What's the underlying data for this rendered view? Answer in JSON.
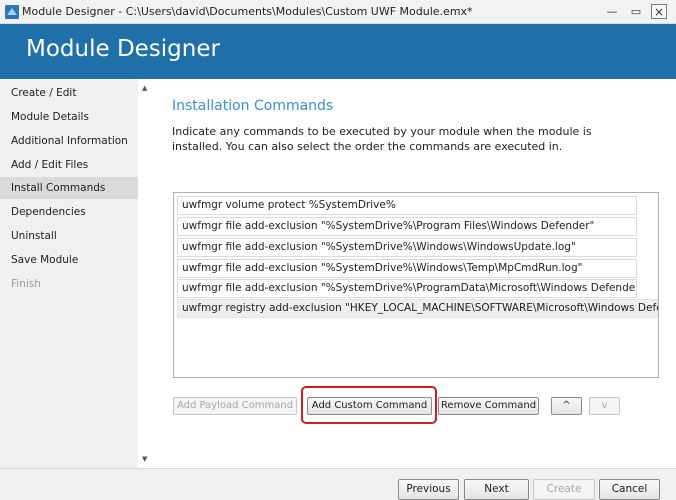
{
  "window": {
    "title": "Module Designer - C:\\Users\\david\\Documents\\Modules\\Custom UWF Module.emx*",
    "minimize_glyph": "—",
    "maximize_glyph": "▭",
    "close_glyph": "×"
  },
  "header": {
    "title": "Module Designer"
  },
  "sidebar": {
    "items": [
      {
        "label": "Create / Edit"
      },
      {
        "label": "Module Details"
      },
      {
        "label": "Additional Information"
      },
      {
        "label": "Add / Edit Files"
      },
      {
        "label": "Install Commands"
      },
      {
        "label": "Dependencies"
      },
      {
        "label": "Uninstall"
      },
      {
        "label": "Save Module"
      },
      {
        "label": "Finish"
      }
    ]
  },
  "main": {
    "section_title": "Installation Commands",
    "description": "Indicate any commands to be executed by your module when the module is installed. You can also select the order the commands are executed in.",
    "commands": [
      "uwfmgr volume protect %SystemDrive%",
      "uwfmgr file add-exclusion \"%SystemDrive%\\Program Files\\Windows Defender\"",
      "uwfmgr file add-exclusion \"%SystemDrive%\\Windows\\WindowsUpdate.log\"",
      "uwfmgr file add-exclusion \"%SystemDrive%\\Windows\\Temp\\MpCmdRun.log\"",
      "uwfmgr file add-exclusion \"%SystemDrive%\\ProgramData\\Microsoft\\Windows Defender\"",
      "uwfmgr registry add-exclusion \"HKEY_LOCAL_MACHINE\\SOFTWARE\\Microsoft\\Windows Defender\""
    ],
    "buttons": {
      "add_payload": "Add Payload Command",
      "add_custom": "Add Custom Command",
      "remove": "Remove Command",
      "move_up": "^",
      "move_down": "v"
    }
  },
  "scroll": {
    "up_glyph": "▲",
    "down_glyph": "▼"
  },
  "footer": {
    "previous": "Previous",
    "next": "Next",
    "create": "Create",
    "cancel": "Cancel"
  },
  "colors": {
    "header_bg": "#1f6fa8",
    "section_title": "#3a8fd0",
    "highlight_outline": "#d11d1d"
  }
}
